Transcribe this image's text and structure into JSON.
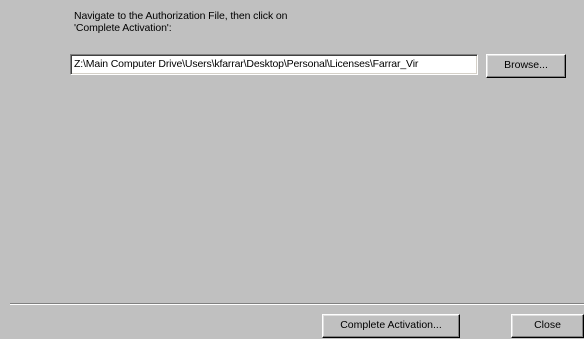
{
  "instructions": {
    "line1": "Navigate to the Authorization File, then click on",
    "line2": "'Complete Activation':"
  },
  "path_field": {
    "value": "Z:\\Main Computer Drive\\Users\\kfarrar\\Desktop\\Personal\\Licenses\\Farrar_Vir"
  },
  "buttons": {
    "browse": "Browse...",
    "complete_activation": "Complete Activation...",
    "close": "Close"
  }
}
